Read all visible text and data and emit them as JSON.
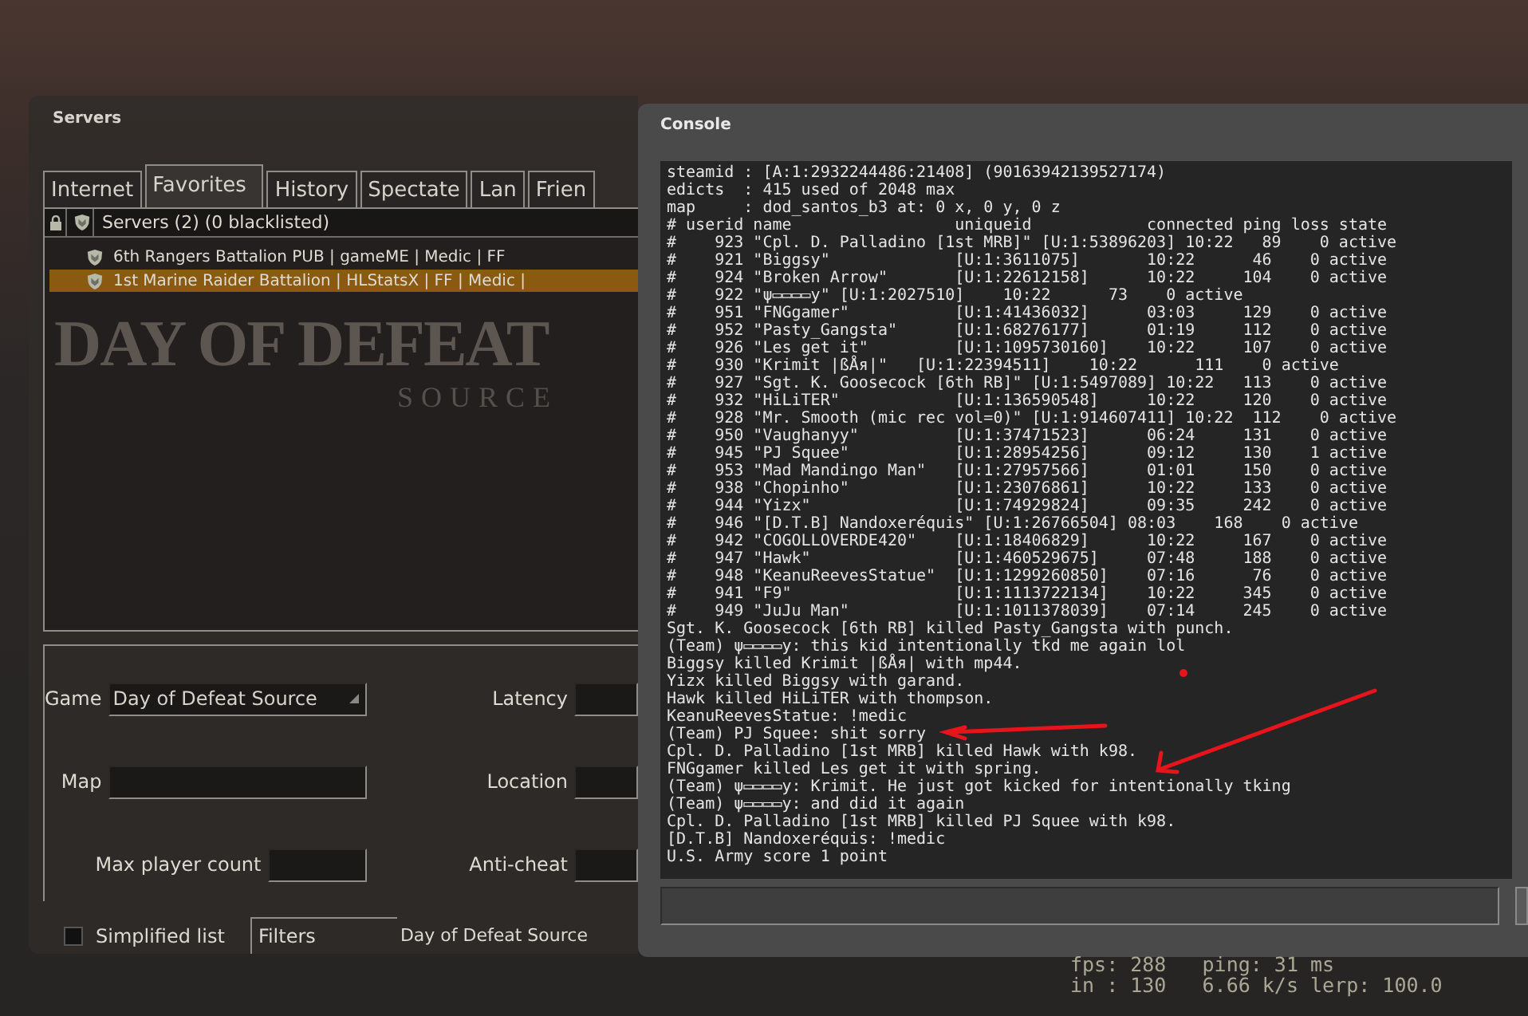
{
  "background_logo": {
    "title": "DAY OF DEFEAT",
    "subtitle": "SOURCE"
  },
  "servers_window": {
    "title": "Servers",
    "tabs": [
      {
        "label": "Internet",
        "selected": false
      },
      {
        "label": "Favorites",
        "selected": true
      },
      {
        "label": "History",
        "selected": false
      },
      {
        "label": "Spectate",
        "selected": false
      },
      {
        "label": "Lan",
        "selected": false
      },
      {
        "label": "Frien",
        "selected": false
      }
    ],
    "list": {
      "header": "Servers (2) (0 blacklisted)",
      "rows": [
        {
          "name": "6th Rangers Battalion PUB | gameME | Medic | FF",
          "selected": false
        },
        {
          "name": "1st Marine Raider Battalion | HLStatsX | FF | Medic |",
          "selected": true
        }
      ]
    },
    "filters": {
      "game": {
        "label": "Game",
        "value": "Day of Defeat Source"
      },
      "map": {
        "label": "Map"
      },
      "max_player_count": {
        "label": "Max player count"
      },
      "latency": {
        "label": "Latency"
      },
      "location": {
        "label": "Location"
      },
      "anti_cheat": {
        "label": "Anti-cheat"
      },
      "simplified_list": {
        "label": "Simplified list",
        "checked": false
      },
      "filters_button": "Filters",
      "summary": "Day of Defeat Source"
    }
  },
  "console_window": {
    "title": "Console",
    "lines": [
      "steamid : [A:1:2932244486:21408] (90163942139527174)",
      "edicts  : 415 used of 2048 max",
      "map     : dod_santos_b3 at: 0 x, 0 y, 0 z",
      "# userid name                 uniqueid            connected ping loss state",
      "#    923 \"Cpl. D. Palladino [1st MRB]\" [U:1:53896203] 10:22   89    0 active",
      "#    921 \"Biggsy\"             [U:1:3611075]       10:22      46    0 active",
      "#    924 \"Broken Arrow\"       [U:1:22612158]      10:22     104    0 active",
      "#    922 \"ψ▭▭▭▭y\" [U:1:2027510]    10:22      73    0 active",
      "#    951 \"FNGgamer\"           [U:1:41436032]      03:03     129    0 active",
      "#    952 \"Pasty_Gangsta\"      [U:1:68276177]      01:19     112    0 active",
      "#    926 \"Les get it\"         [U:1:1095730160]    10:22     107    0 active",
      "#    930 \"Krimit |ßÅя|\"   [U:1:22394511]    10:22      111    0 active",
      "#    927 \"Sgt. K. Goosecock [6th RB]\" [U:1:5497089] 10:22   113    0 active",
      "#    932 \"HiLiTER\"            [U:1:136590548]     10:22     120    0 active",
      "#    928 \"Mr. Smooth (mic rec vol=0)\" [U:1:914607411] 10:22  112    0 active",
      "#    950 \"Vaughanyy\"          [U:1:37471523]      06:24     131    0 active",
      "#    945 \"PJ Squee\"           [U:1:28954256]      09:12     130    1 active",
      "#    953 \"Mad Mandingo Man\"   [U:1:27957566]      01:01     150    0 active",
      "#    938 \"Chopinho\"           [U:1:23076861]      10:22     133    0 active",
      "#    944 \"Yizx\"               [U:1:74929824]      09:35     242    0 active",
      "#    946 \"[D.T.B] Nandoxeréquis\" [U:1:26766504] 08:03    168    0 active",
      "#    942 \"COGOLLOVERDE420\"    [U:1:18406829]      10:22     167    0 active",
      "#    947 \"Hawk\"               [U:1:460529675]     07:48     188    0 active",
      "#    948 \"KeanuReevesStatue\"  [U:1:1299260850]    07:16      76    0 active",
      "#    941 \"F9\"                 [U:1:1113722134]    10:22     345    0 active",
      "#    949 \"JuJu Man\"           [U:1:1011378039]    07:14     245    0 active",
      "Sgt. K. Goosecock [6th RB] killed Pasty_Gangsta with punch.",
      "(Team) ψ▭▭▭▭y: this kid intentionally tkd me again lol",
      "Biggsy killed Krimit |ßÅя| with mp44.",
      "Yizx killed Biggsy with garand.",
      "Hawk killed HiLiTER with thompson.",
      "KeanuReevesStatue: !medic",
      "(Team) PJ Squee: shit sorry",
      "Cpl. D. Palladino [1st MRB] killed Hawk with k98.",
      "FNGgamer killed Les get it with spring.",
      "(Team) ψ▭▭▭▭y: Krimit. He just got kicked for intentionally tking",
      "(Team) ψ▭▭▭▭y: and did it again",
      "Cpl. D. Palladino [1st MRB] killed PJ Squee with k98.",
      "[D.T.B] Nandoxeréquis: !medic",
      "U.S. Army score 1 point"
    ]
  },
  "netgraph": {
    "lines": [
      "fps: 288   ping: 31 ms",
      "in : 130   6.66 k/s lerp: 100.0"
    ]
  }
}
